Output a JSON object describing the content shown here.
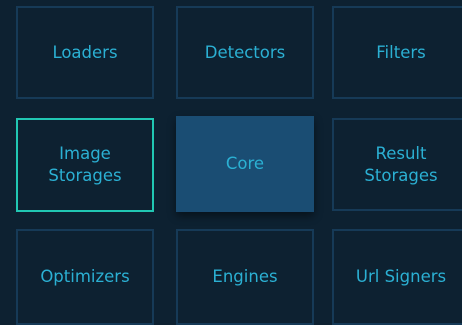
{
  "grid": {
    "loaders": "Loaders",
    "detectors": "Detectors",
    "filters": "Filters",
    "image_storages": "Image\nStorages",
    "core": "Core",
    "result_storages": "Result\nStorages",
    "optimizers": "Optimizers",
    "engines": "Engines",
    "url_signers": "Url Signers"
  },
  "colors": {
    "background": "#0d2131",
    "box_border": "#163a57",
    "highlight_border": "#21c7b3",
    "core_fill": "#1a4d73",
    "text": "#2bb0d3"
  }
}
